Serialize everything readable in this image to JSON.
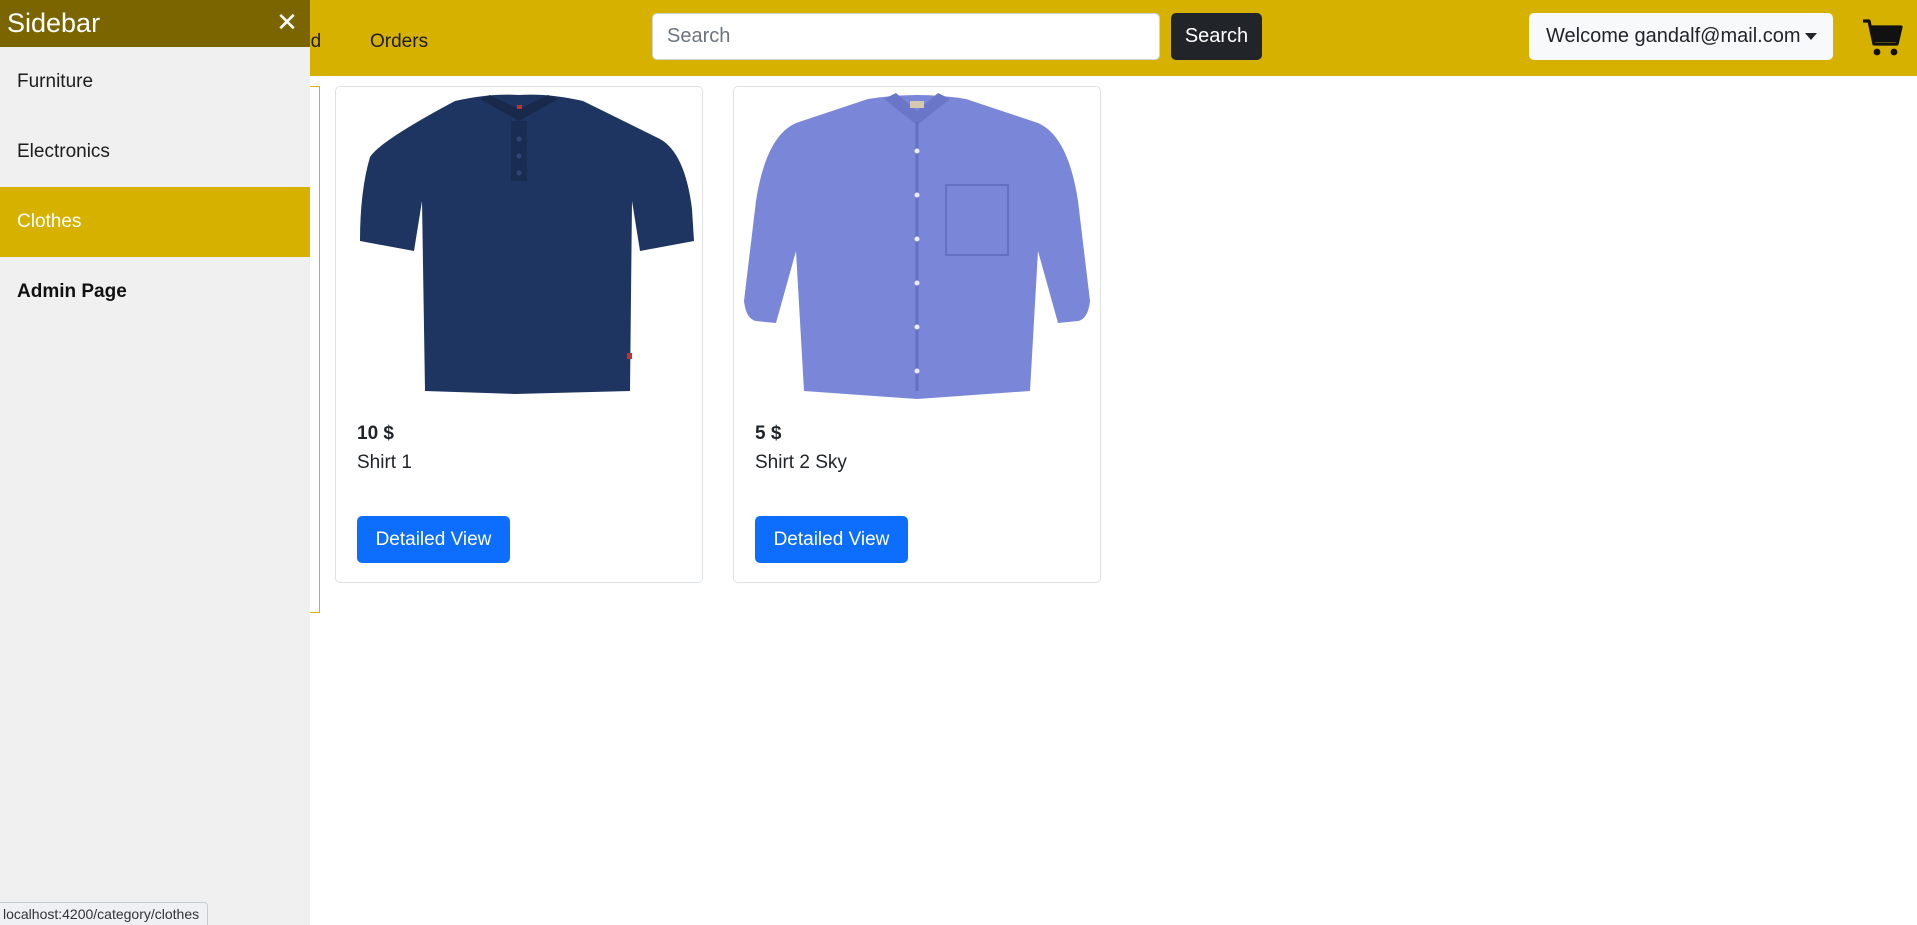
{
  "navbar": {
    "partial_link_label": "ed",
    "orders_label": "Orders",
    "search_placeholder": "Search",
    "search_button_label": "Search",
    "user_menu_label": "Welcome gandalf@mail.com",
    "cart_icon": "shopping-cart-icon"
  },
  "products": [
    {
      "price": "10 $",
      "name": "Shirt 1",
      "button_label": "Detailed View",
      "image": "navy-polo-shirt"
    },
    {
      "price": "5 $",
      "name": "Shirt 2 Sky",
      "button_label": "Detailed View",
      "image": "blue-button-down-shirt"
    }
  ],
  "sidebar": {
    "title": "Sidebar",
    "close_glyph": "✕",
    "items": [
      {
        "label": "Furniture"
      },
      {
        "label": "Electronics"
      },
      {
        "label": "Clothes"
      },
      {
        "label": "Admin Page"
      }
    ]
  },
  "status_bar": {
    "url": "localhost:4200/category/clothes"
  },
  "colors": {
    "navbar_bg": "#d6b100",
    "sidebar_header_bg": "#7a6500",
    "sidebar_active_bg": "#d6b100",
    "primary_button": "#0d6efd",
    "dark_button": "#212529"
  }
}
